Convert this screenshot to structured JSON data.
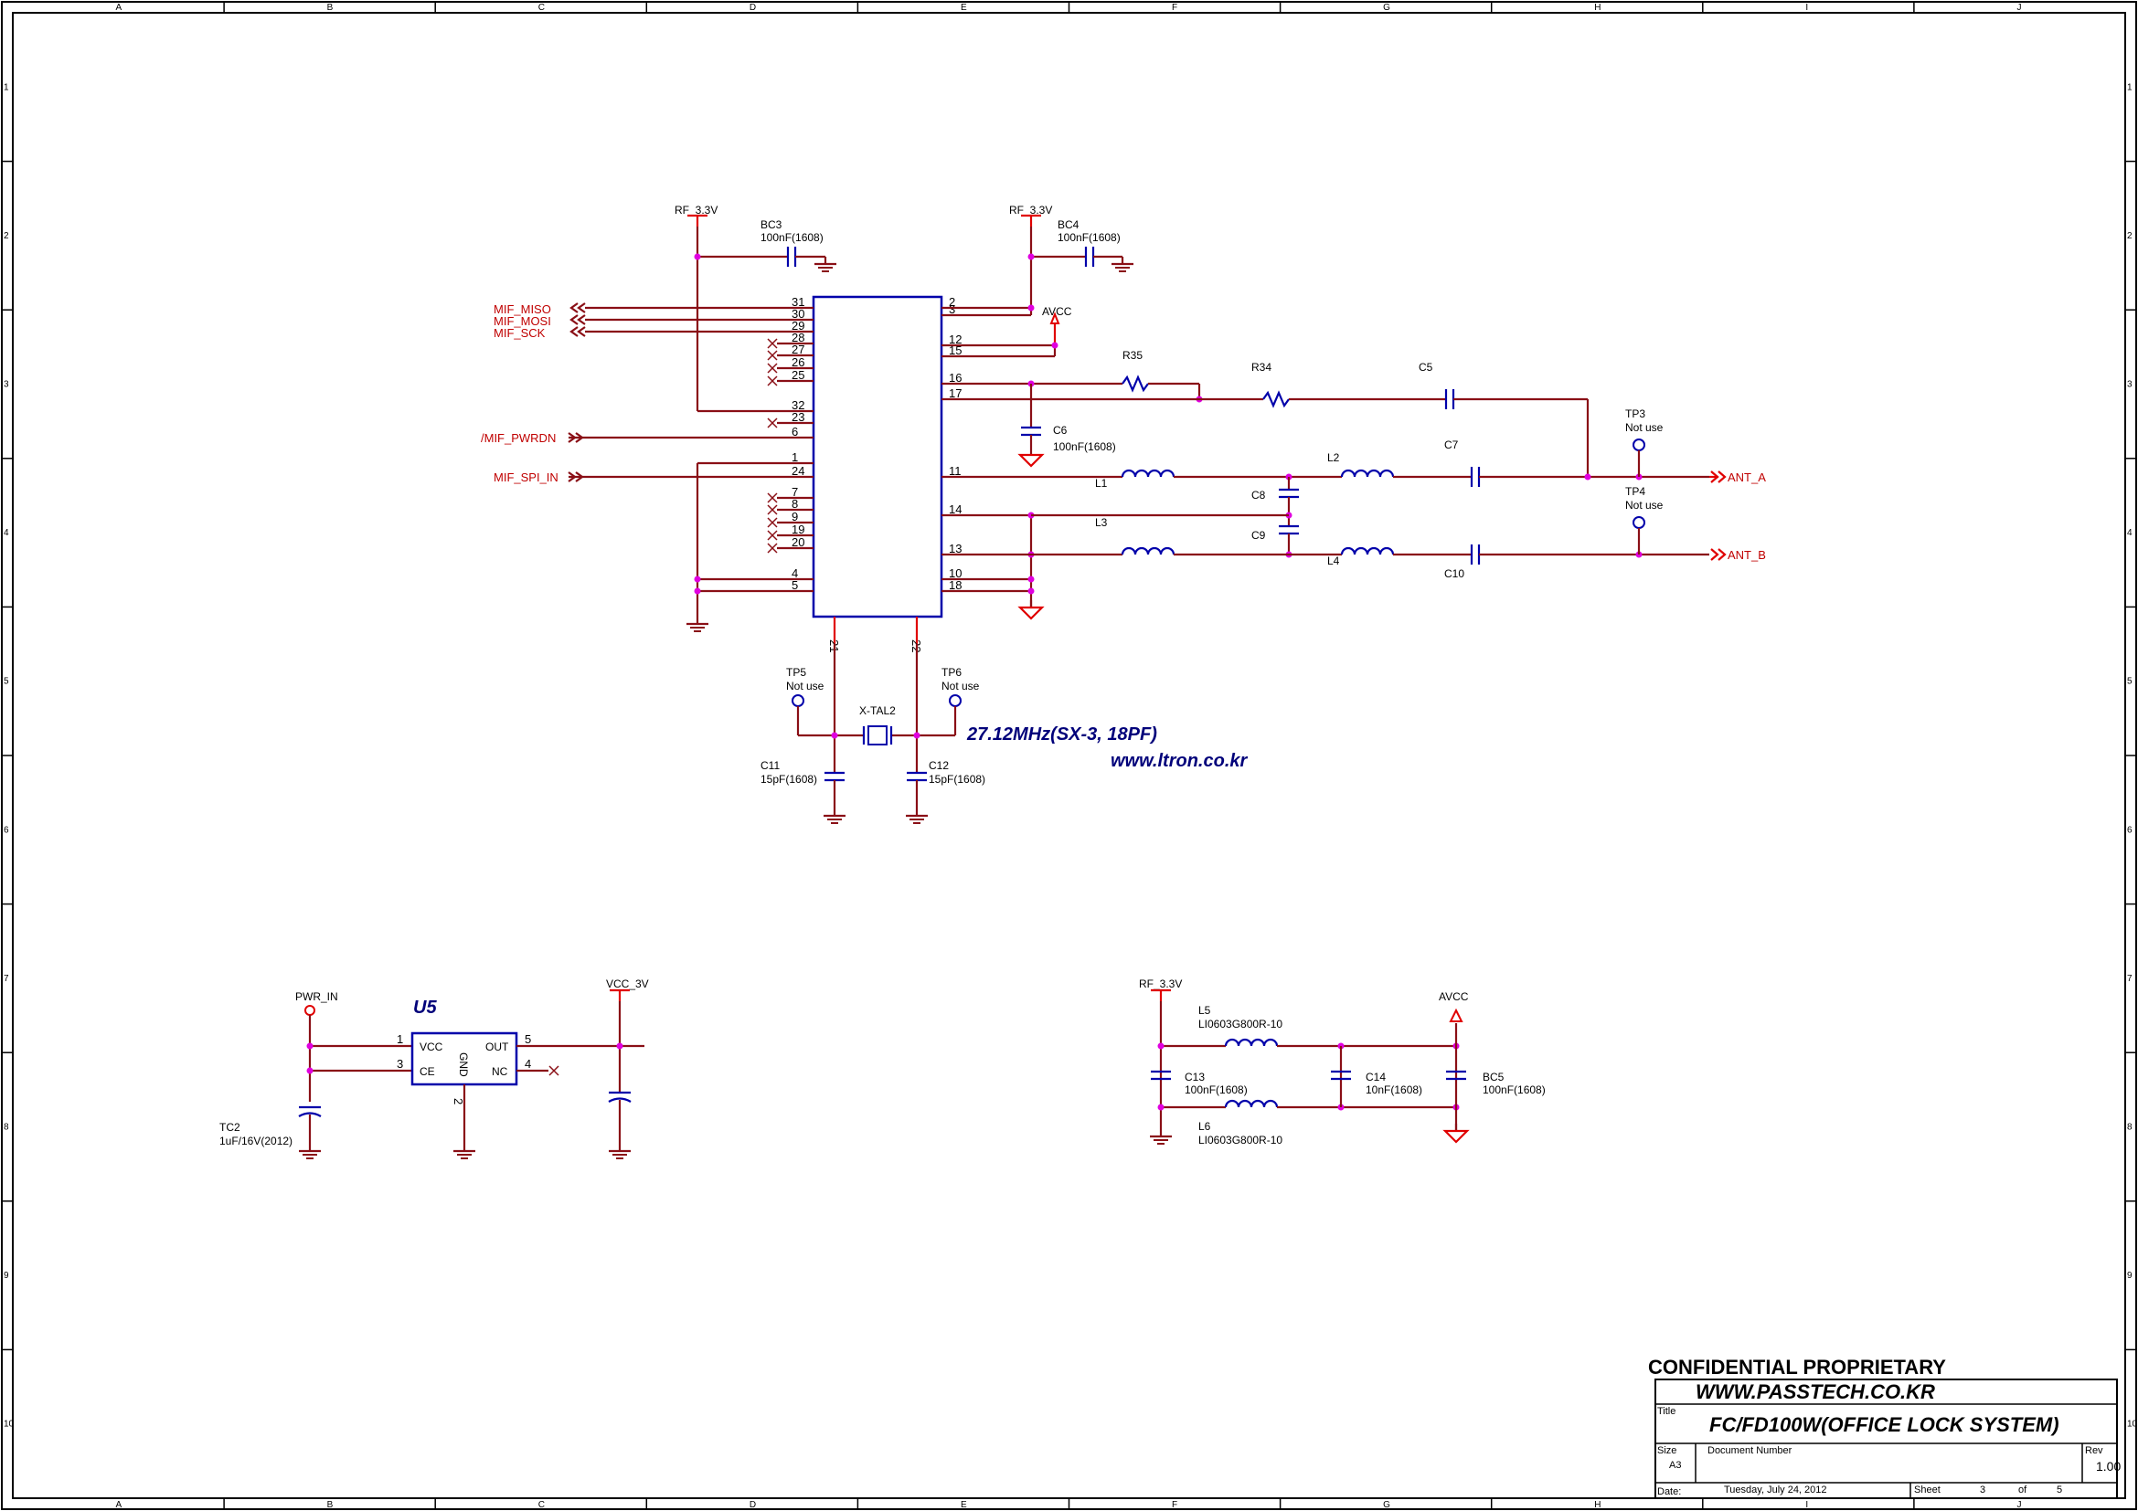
{
  "frame": {
    "columns": [
      "A",
      "B",
      "C",
      "D",
      "E",
      "F",
      "G",
      "H",
      "I",
      "J"
    ],
    "rows": [
      "1",
      "2",
      "3",
      "4",
      "5",
      "6",
      "7",
      "8",
      "9",
      "10"
    ]
  },
  "rails": {
    "rf33_a": "RF_3.3V",
    "rf33_b": "RF_3.3V",
    "rf33_c": "RF_3.3V",
    "avcc_a": "AVCC",
    "avcc_b": "AVCC",
    "pwr_in": "PWR_IN",
    "vcc_3v": "VCC_3V"
  },
  "nets": {
    "miso": "MIF_MISO",
    "mosi": "MIF_MOSI",
    "sck": "MIF_SCK",
    "pwrdn": "/MIF_PWRDN",
    "spi_in": "MIF_SPI_IN",
    "ant_a": "ANT_A",
    "ant_b": "ANT_B"
  },
  "ic_pins": {
    "left": [
      "31",
      "30",
      "29",
      "28",
      "27",
      "26",
      "25",
      "32",
      "23",
      "6",
      "1",
      "24",
      "7",
      "8",
      "9",
      "19",
      "20",
      "4",
      "5"
    ],
    "right": [
      "2",
      "3",
      "12",
      "15",
      "16",
      "17",
      "11",
      "14",
      "13",
      "10",
      "18"
    ],
    "bottom": [
      "21",
      "22"
    ]
  },
  "components": {
    "bc3": {
      "ref": "BC3",
      "value": "100nF(1608)"
    },
    "bc4": {
      "ref": "BC4",
      "value": "100nF(1608)"
    },
    "r35": {
      "ref": "R35"
    },
    "r34": {
      "ref": "R34"
    },
    "c5": {
      "ref": "C5"
    },
    "c6": {
      "ref": "C6",
      "value": "100nF(1608)"
    },
    "c7": {
      "ref": "C7"
    },
    "l1": {
      "ref": "L1"
    },
    "l2": {
      "ref": "L2"
    },
    "l3": {
      "ref": "L3"
    },
    "l4": {
      "ref": "L4"
    },
    "c8": {
      "ref": "C8"
    },
    "c9": {
      "ref": "C9"
    },
    "c10": {
      "ref": "C10"
    },
    "tp3": {
      "ref": "TP3",
      "value": "Not use"
    },
    "tp4": {
      "ref": "TP4",
      "value": "Not use"
    },
    "tp5": {
      "ref": "TP5",
      "value": "Not use"
    },
    "tp6": {
      "ref": "TP6",
      "value": "Not use"
    },
    "xtal": {
      "ref": "X-TAL2"
    },
    "c11": {
      "ref": "C11",
      "value": "15pF(1608)"
    },
    "c12": {
      "ref": "C12",
      "value": "15pF(1608)"
    },
    "u5": {
      "ref": "U5",
      "pins": {
        "vcc": "VCC",
        "ce": "CE",
        "gnd": "GND",
        "out": "OUT",
        "nc": "NC"
      },
      "pin_numbers": [
        "1",
        "3",
        "2",
        "5",
        "4"
      ]
    },
    "tc2": {
      "ref": "TC2",
      "value": "1uF/16V(2012)"
    },
    "l5": {
      "ref": "L5",
      "value": "LI0603G800R-10"
    },
    "l6": {
      "ref": "L6",
      "value": "LI0603G800R-10"
    },
    "c13": {
      "ref": "C13",
      "value": "100nF(1608)"
    },
    "c14": {
      "ref": "C14",
      "value": "10nF(1608)"
    },
    "bc5": {
      "ref": "BC5",
      "value": "100nF(1608)"
    }
  },
  "notes": {
    "crystal": "27.12MHz(SX-3, 18PF)",
    "website": "www.ltron.co.kr"
  },
  "title_block": {
    "confidential": "CONFIDENTIAL PROPRIETARY",
    "company": "WWW.PASSTECH.CO.KR",
    "title_label": "Title",
    "title": "FC/FD100W(OFFICE LOCK  SYSTEM)",
    "size_label": "Size",
    "size": "A3",
    "docnum_label": "Document Number",
    "rev_label": "Rev",
    "rev": "1.00",
    "date_label": "Date:",
    "date": "Tuesday, July 24, 2012",
    "sheet_label": "Sheet",
    "sheet": "3",
    "of_label": "of",
    "total": "5"
  }
}
